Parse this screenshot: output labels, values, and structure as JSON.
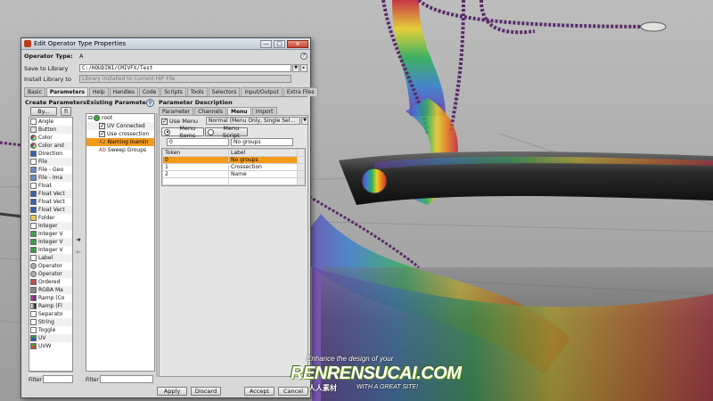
{
  "window": {
    "title": "Edit Operator Type Properties",
    "minimize_label": "—",
    "maximize_label": "□",
    "close_label": "x"
  },
  "operator_type": {
    "label": "Operator Type:",
    "value": "A"
  },
  "save_to_library": {
    "label": "Save to Library",
    "value": "C:/HOUDINI/CMIVFX/Test"
  },
  "install_library": {
    "label": "Install Library to",
    "value": "Library installed to Current HIP File"
  },
  "tabs": [
    {
      "label": "Basic"
    },
    {
      "label": "Parameters"
    },
    {
      "label": "Help"
    },
    {
      "label": "Handles"
    },
    {
      "label": "Code"
    },
    {
      "label": "Scripts"
    },
    {
      "label": "Tools"
    },
    {
      "label": "Selectors"
    },
    {
      "label": "Input/Output"
    },
    {
      "label": "Extra Files"
    }
  ],
  "create_parameters": {
    "title": "Create Parameters",
    "sort_label": "By...",
    "items": [
      {
        "label": "Angle",
        "icon": "angle-icon"
      },
      {
        "label": "Button",
        "icon": "button-icon"
      },
      {
        "label": "Color",
        "icon": "color-icon"
      },
      {
        "label": "Color and",
        "icon": "color-alpha-icon"
      },
      {
        "label": "Direction",
        "icon": "direction-icon"
      },
      {
        "label": "File",
        "icon": "file-icon"
      },
      {
        "label": "File - Geo",
        "icon": "file-geo-icon"
      },
      {
        "label": "File - Ima",
        "icon": "file-image-icon"
      },
      {
        "label": "Float",
        "icon": "float-icon"
      },
      {
        "label": "Float Vect",
        "icon": "float-vector-icon"
      },
      {
        "label": "Float Vect",
        "icon": "float-vector-icon"
      },
      {
        "label": "Float Vect",
        "icon": "float-vector-icon"
      },
      {
        "label": "Folder",
        "icon": "folder-icon"
      },
      {
        "label": "Integer",
        "icon": "integer-icon"
      },
      {
        "label": "Integer V",
        "icon": "integer-vector-icon"
      },
      {
        "label": "Integer V",
        "icon": "integer-vector-icon"
      },
      {
        "label": "Integer V",
        "icon": "integer-vector-icon"
      },
      {
        "label": "Label",
        "icon": "label-icon"
      },
      {
        "label": "Operator",
        "icon": "operator-icon"
      },
      {
        "label": "Operator",
        "icon": "operator-icon"
      },
      {
        "label": "Ordered",
        "icon": "ordered-icon"
      },
      {
        "label": "RGBA Ma",
        "icon": "rgba-icon"
      },
      {
        "label": "Ramp (Co",
        "icon": "ramp-color-icon"
      },
      {
        "label": "Ramp (Fl",
        "icon": "ramp-float-icon"
      },
      {
        "label": "Separato",
        "icon": "separator-icon"
      },
      {
        "label": "String",
        "icon": "string-icon"
      },
      {
        "label": "Toggle",
        "icon": "toggle-icon"
      },
      {
        "label": "UV",
        "icon": "uv-icon"
      },
      {
        "label": "UVW",
        "icon": "uvw-icon"
      }
    ],
    "filter_label": "Filter"
  },
  "existing_parameters": {
    "title": "Existing Parameters",
    "root_label": "root",
    "items": [
      {
        "label": "UV Connected",
        "icon": "checkbox-icon"
      },
      {
        "label": "Use crossection",
        "icon": "checkbox-icon"
      },
      {
        "label": "Naming Inamin",
        "icon": "integer-icon"
      },
      {
        "label": "Sweep Groups",
        "icon": "string-icon"
      }
    ],
    "filter_label": "Filter"
  },
  "parameter_description": {
    "title": "Parameter Description",
    "tabs": [
      {
        "label": "Parameter"
      },
      {
        "label": "Channels"
      },
      {
        "label": "Menu"
      },
      {
        "label": "Import"
      }
    ],
    "use_menu_label": "Use Menu",
    "menu_type": "Normal (Menu Only, Single Sel...",
    "menu_items_label": "Menu Items",
    "menu_script_label": "Menu Script",
    "default_token": "0",
    "default_label": "No groups",
    "columns": [
      "Token",
      "Label"
    ],
    "rows": [
      {
        "token": "0",
        "label": "No groups"
      },
      {
        "token": "1",
        "label": "Crossection"
      },
      {
        "token": "2",
        "label": "Name"
      },
      {
        "token": "",
        "label": ""
      }
    ]
  },
  "buttons": {
    "apply": "Apply",
    "discard": "Discard",
    "accept": "Accept",
    "cancel": "Cancel"
  },
  "watermark": {
    "tagline": "Enhance the design of your",
    "brand": "RENRENSUCAI.COM",
    "sub_cn": "人人素材",
    "sub_en": "WITH A GREAT SITE!"
  },
  "colors": {
    "selection": "#f49a1a",
    "dialog_bg": "#d8d8d8"
  }
}
